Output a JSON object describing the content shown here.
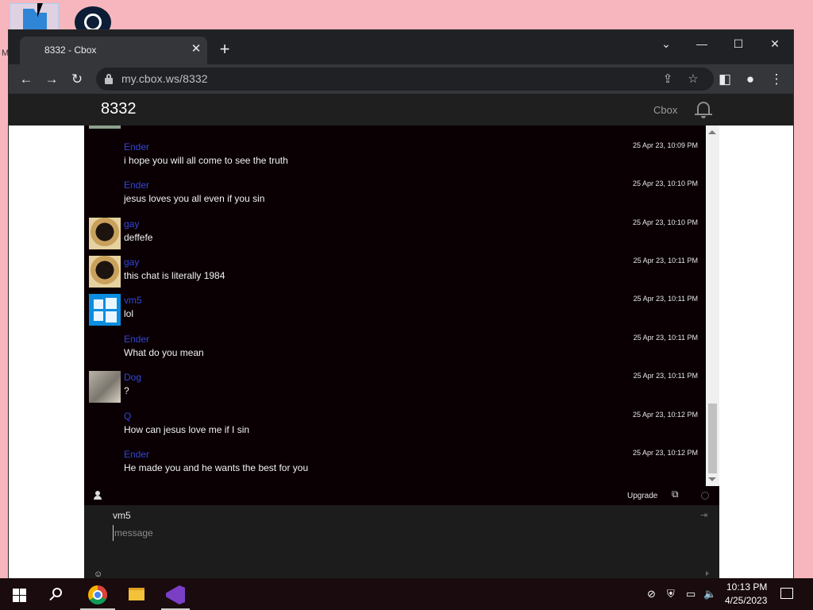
{
  "desktop": {
    "icon_label_partial": "M",
    "icons": [
      "folder-icon",
      "steam-icon"
    ]
  },
  "browser": {
    "tab": {
      "title": "8332 - Cbox",
      "close_glyph": "✕"
    },
    "new_tab_glyph": "+",
    "window_controls": {
      "tablist": "⌄",
      "minimize": "—",
      "maximize": "☐",
      "close": "✕"
    },
    "nav": {
      "back": "←",
      "forward": "→",
      "reload": "↻"
    },
    "address": {
      "url": "my.cbox.ws/8332"
    },
    "omni_icons": {
      "share": "⇪",
      "bookmark": "☆"
    },
    "right_icons": {
      "sidebar": "◧",
      "profile": "●",
      "menu": "⋮"
    }
  },
  "cbox": {
    "title": "8332",
    "brand": "Cbox",
    "messages": [
      {
        "user": "Ender",
        "text": "i hope you will all come to see the truth",
        "time": "25 Apr 23, 10:09 PM",
        "avatar": "none"
      },
      {
        "user": "Ender",
        "text": "jesus loves you all even if you sin",
        "time": "25 Apr 23, 10:10 PM",
        "avatar": "none"
      },
      {
        "user": "gay",
        "text": "deffefe",
        "time": "25 Apr 23, 10:10 PM",
        "avatar": "pug"
      },
      {
        "user": "gay",
        "text": "this chat is literally 1984",
        "time": "25 Apr 23, 10:11 PM",
        "avatar": "pug"
      },
      {
        "user": "vm5",
        "text": "lol",
        "time": "25 Apr 23, 10:11 PM",
        "avatar": "windows"
      },
      {
        "user": "Ender",
        "text": "What do you mean",
        "time": "25 Apr 23, 10:11 PM",
        "avatar": "none"
      },
      {
        "user": "Dog",
        "text": "?",
        "time": "25 Apr 23, 10:11 PM",
        "avatar": "dog"
      },
      {
        "user": "Q",
        "text": "How can jesus love me if I sin",
        "time": "25 Apr 23, 10:12 PM",
        "avatar": "none"
      },
      {
        "user": "Ender",
        "text": "He made you and he wants the best for you",
        "time": "25 Apr 23, 10:12 PM",
        "avatar": "none"
      }
    ],
    "status_bar": {
      "upgrade": "Upgrade",
      "popout_glyph": "⧉"
    },
    "compose": {
      "name": "vm5",
      "placeholder": "message",
      "login_glyph": "⇥",
      "emoji_glyph": "☺"
    }
  },
  "taskbar": {
    "clock": {
      "time": "10:13 PM",
      "date": "4/25/2023"
    },
    "tray": {
      "network": "▭",
      "volume": "🔈"
    }
  }
}
